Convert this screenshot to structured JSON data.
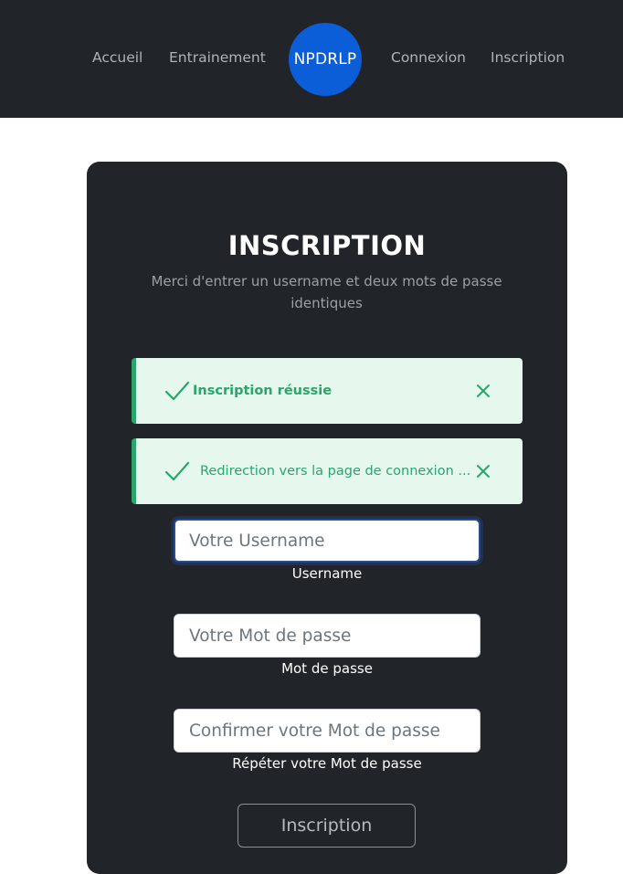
{
  "nav": {
    "accueil": "Accueil",
    "entrainement": "Entrainement",
    "logo": "NPDRLP",
    "connexion": "Connexion",
    "inscription": "Inscription"
  },
  "form": {
    "title": "INSCRIPTION",
    "subtitle": "Merci d'entrer un username et deux mots de passe identiques",
    "alerts": [
      {
        "text": "Inscription réussie",
        "icon": "check-icon",
        "color": "#2aa56b"
      },
      {
        "text": "Redirection vers la page de connexion ...",
        "icon": "check-icon",
        "color": "#2aa56b"
      }
    ],
    "username": {
      "placeholder": "Votre Username",
      "value": "",
      "label": "Username"
    },
    "password": {
      "placeholder": "Votre Mot de passe",
      "value": "",
      "label": "Mot de passe"
    },
    "confirm": {
      "placeholder": "Confirmer votre Mot de passe",
      "value": "",
      "label": "Répéter votre Mot de passe"
    },
    "submit_label": "Inscription"
  },
  "colors": {
    "navbar": "#212529",
    "card": "#212529",
    "logo": "#0b5ed7",
    "success": "#2aa56b",
    "success_bg": "#e6f7ee"
  }
}
